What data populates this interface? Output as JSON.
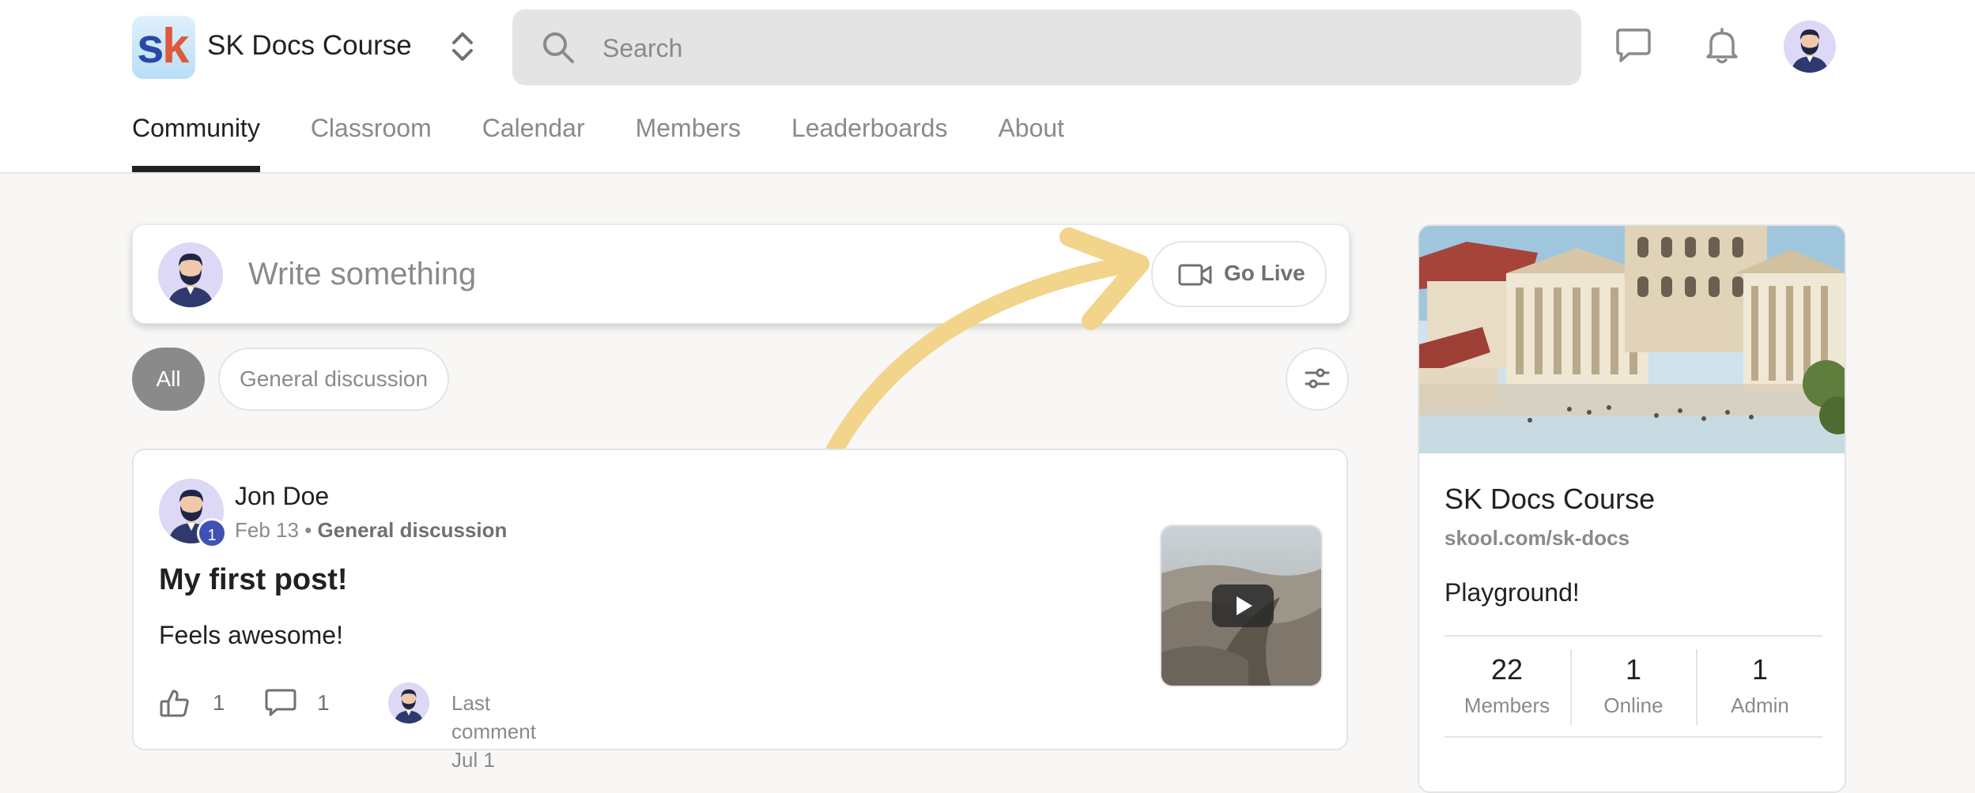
{
  "brand": {
    "logo_letters": "sk",
    "course_name": "SK Docs Course"
  },
  "search": {
    "placeholder": "Search"
  },
  "nav": {
    "tabs": [
      "Community",
      "Classroom",
      "Calendar",
      "Members",
      "Leaderboards",
      "About"
    ],
    "active_tab": "Community"
  },
  "composer": {
    "placeholder": "Write something",
    "go_live_label": "Go Live"
  },
  "filters": {
    "chips": [
      "All",
      "General discussion"
    ],
    "active": "All"
  },
  "post": {
    "author": "Jon Doe",
    "level": "1",
    "date": "Feb 13",
    "separator": "•",
    "category": "General discussion",
    "title": "My first post!",
    "body": "Feels awesome!",
    "likes": "1",
    "comments": "1",
    "last_comment": "Last comment Jul 1"
  },
  "sidebar": {
    "title": "SK Docs Course",
    "url": "skool.com/sk-docs",
    "description": "Playground!",
    "stats": [
      {
        "value": "22",
        "label": "Members"
      },
      {
        "value": "1",
        "label": "Online"
      },
      {
        "value": "1",
        "label": "Admin"
      }
    ]
  },
  "colors": {
    "accent_arrow": "#f2d48a",
    "level_badge": "#3f51b5",
    "chip_active": "#8a8a8a"
  },
  "icons": [
    "search-icon",
    "chat-icon",
    "bell-icon",
    "video-camera-icon",
    "sliders-icon",
    "thumbs-up-icon",
    "comment-icon",
    "play-icon",
    "chevron-up-down-icon"
  ]
}
